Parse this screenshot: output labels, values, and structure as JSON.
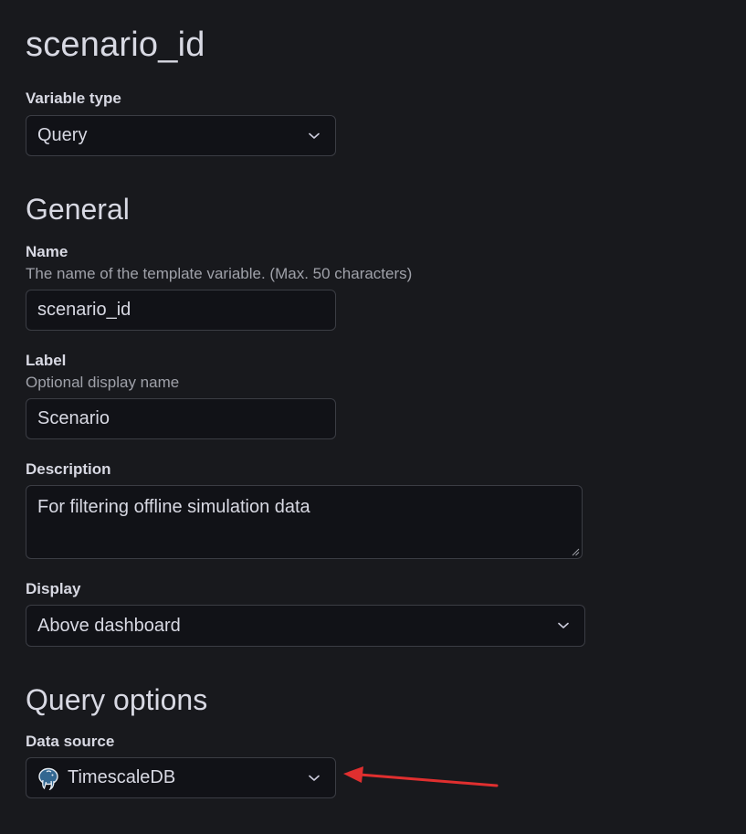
{
  "page": {
    "title": "scenario_id"
  },
  "variable_type": {
    "label": "Variable type",
    "value": "Query"
  },
  "general": {
    "title": "General",
    "name": {
      "label": "Name",
      "description": "The name of the template variable. (Max. 50 characters)",
      "value": "scenario_id"
    },
    "label": {
      "label": "Label",
      "description": "Optional display name",
      "value": "Scenario"
    },
    "description": {
      "label": "Description",
      "value": "For filtering offline simulation data"
    },
    "display": {
      "label": "Display",
      "value": "Above dashboard"
    }
  },
  "query_options": {
    "title": "Query options",
    "data_source": {
      "label": "Data source",
      "value": "TimescaleDB",
      "icon": "postgresql-elephant-icon"
    }
  },
  "annotation": {
    "arrow_color": "#e02f2f"
  }
}
